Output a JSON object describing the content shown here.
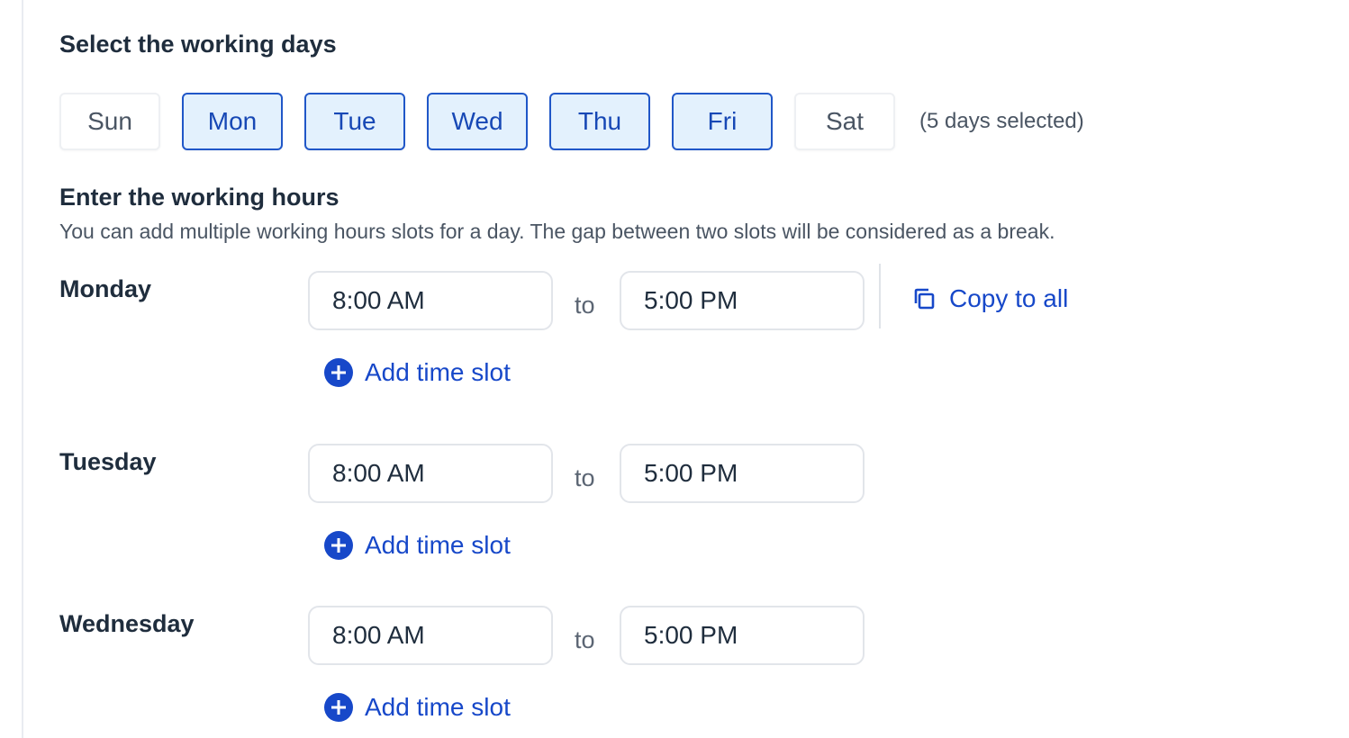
{
  "working_days": {
    "title": "Select the working days",
    "days": [
      {
        "label": "Sun",
        "selected": false
      },
      {
        "label": "Mon",
        "selected": true
      },
      {
        "label": "Tue",
        "selected": true
      },
      {
        "label": "Wed",
        "selected": true
      },
      {
        "label": "Thu",
        "selected": true
      },
      {
        "label": "Fri",
        "selected": true
      },
      {
        "label": "Sat",
        "selected": false
      }
    ],
    "count_text": "(5 days selected)"
  },
  "working_hours": {
    "title": "Enter the working hours",
    "helper": "You can add multiple working hours slots for a day. The gap between two slots will be considered as a break.",
    "to_label": "to",
    "add_slot_label": "Add time slot",
    "copy_all_label": "Copy to all",
    "schedule": [
      {
        "day": "Monday",
        "start": "8:00 AM",
        "end": "5:00 PM"
      },
      {
        "day": "Tuesday",
        "start": "8:00 AM",
        "end": "5:00 PM"
      },
      {
        "day": "Wednesday",
        "start": "8:00 AM",
        "end": "5:00 PM"
      }
    ]
  },
  "colors": {
    "accent": "#1748c9",
    "selected_bg": "#e3f1fd",
    "selected_border": "#2057c8",
    "text_primary": "#1f2d3d",
    "text_secondary": "#4a5563"
  },
  "icons": {
    "copy": "copy-icon",
    "add": "plus-circle-icon"
  }
}
